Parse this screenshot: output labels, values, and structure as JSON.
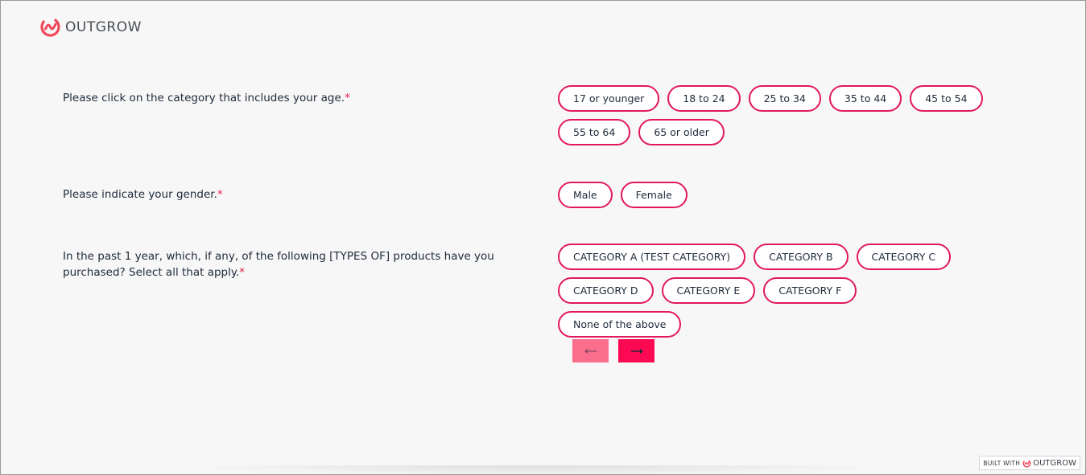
{
  "header": {
    "brand": "OUTGROW",
    "brand_color": "#f0485a"
  },
  "questions": [
    {
      "label": "Please click on the category that includes your age.",
      "required_mark": "*",
      "options": [
        "17 or younger",
        "18 to 24",
        "25 to 34",
        "35 to 44",
        "45 to 54",
        "55 to 64",
        "65 or older"
      ]
    },
    {
      "label": "Please indicate your gender.",
      "required_mark": "*",
      "options": [
        "Male",
        "Female"
      ]
    },
    {
      "label_line1": "In the past 1 year, which, if any, of the following [TYPES OF] products have you",
      "label_line2": "purchased? Select all that apply.",
      "required_mark": "*",
      "options": [
        "CATEGORY A (TEST CATEGORY)",
        "CATEGORY B",
        "CATEGORY C",
        "CATEGORY D",
        "CATEGORY E",
        "CATEGORY F",
        "None of the above"
      ]
    }
  ],
  "navigation": {
    "prev_icon": "arrow-left-icon",
    "next_icon": "arrow-right-icon",
    "prev_color": "#fb6d8d",
    "next_color": "#fb0a53"
  },
  "footer_badge": {
    "built_with": "BUILT WITH",
    "brand": "OUTGROW"
  },
  "colors": {
    "accent": "#e2185b",
    "background": "#f7f7f7",
    "text": "#1e2a3a"
  }
}
